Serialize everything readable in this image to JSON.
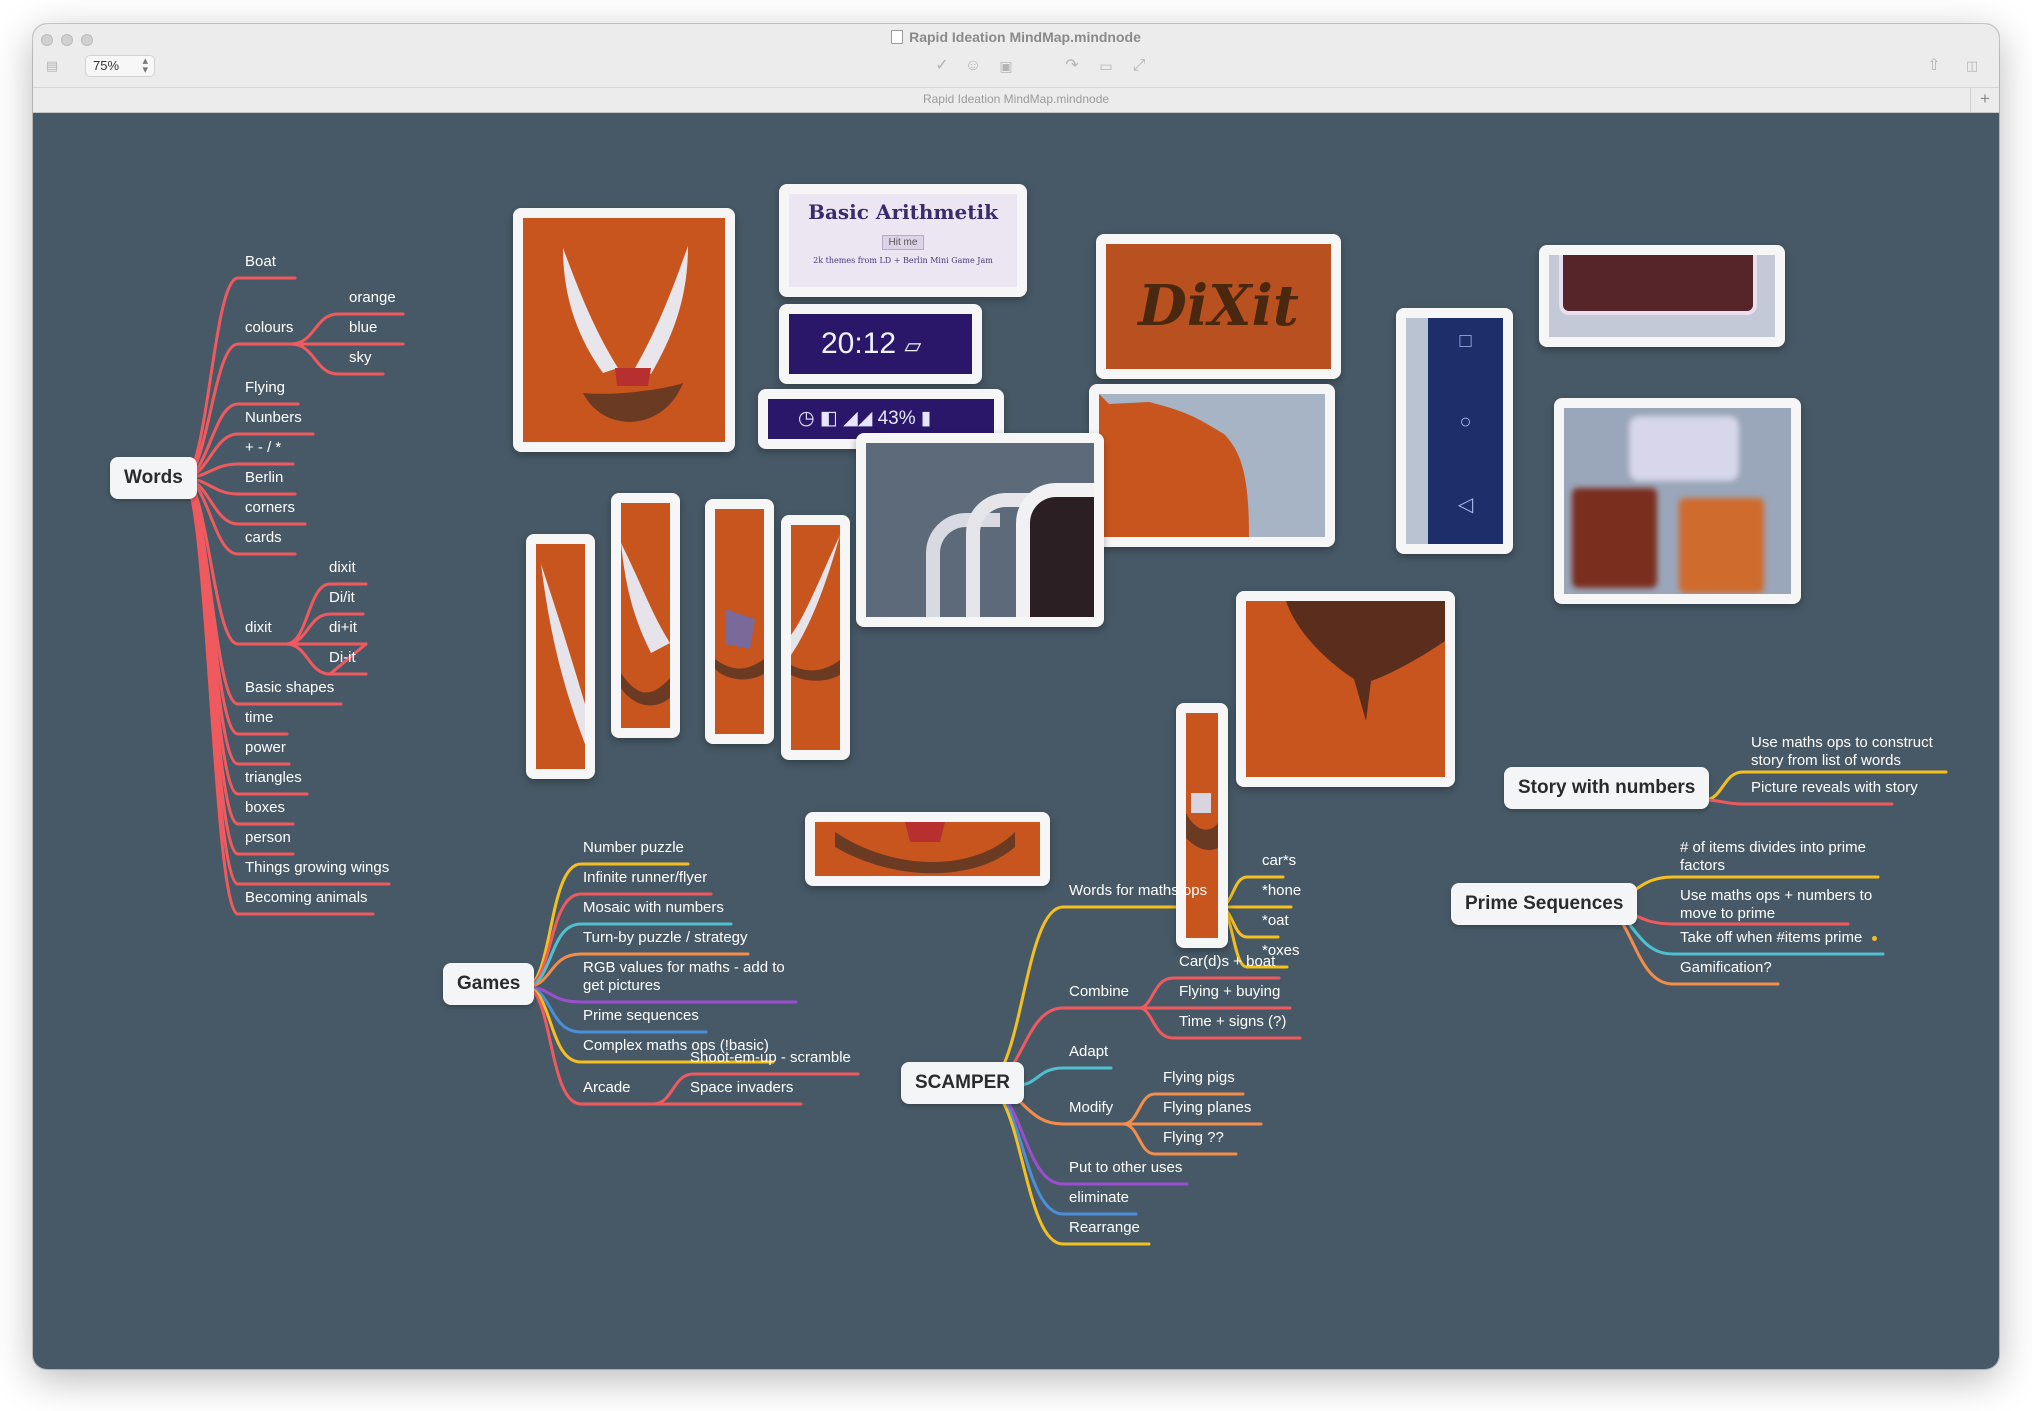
{
  "window": {
    "title": "Rapid Ideation MindMap.mindnode",
    "tab_label": "Rapid Ideation MindMap.mindnode",
    "zoom": "75%",
    "add_tab_label": "+"
  },
  "toolbar_icons": [
    "sidebar-icon",
    "check-icon",
    "smiley-icon",
    "image-icon",
    "undo-icon",
    "link-icon",
    "collapse-icon",
    "share-icon",
    "inspector-icon"
  ],
  "colors": {
    "canvas": "#475966",
    "red": "#f05a5f",
    "yellow": "#f4c021",
    "cyan": "#4fc0d0",
    "orange": "#f58d4a",
    "purple": "#9b4fd0",
    "blue": "#4a8fd8",
    "node_bg": "#f4f5f6"
  },
  "images": {
    "arithmetik_title": "Basic Arithmetik",
    "arithmetik_button": "Hit me",
    "arithmetik_footer": "2k themes from LD + Berlin Mini Game Jam",
    "clock_time": "20:12",
    "battery": "43%",
    "dixit_logo": "DiXit"
  },
  "words": {
    "root": "Words",
    "boat": "Boat",
    "colours": "colours",
    "orange": "orange",
    "blue": "blue",
    "sky": "sky",
    "flying": "Flying",
    "nunbers": "Nunbers",
    "ops": "+ - / *",
    "berlin": "Berlin",
    "corners": "corners",
    "cards": "cards",
    "dixit": "dixit",
    "dixit_1": "dixit",
    "dixit_2": "Di/it",
    "dixit_3": "di+it",
    "dixit_4": "Di-it",
    "basic_shapes": "Basic shapes",
    "time": "time",
    "power": "power",
    "triangles": "triangles",
    "boxes": "boxes",
    "person": "person",
    "things_growing_wings": "Things growing wings",
    "becoming_animals": "Becoming animals"
  },
  "games": {
    "root": "Games",
    "number_puzzle": "Number puzzle",
    "infinite_runner": "Infinite runner/flyer",
    "mosaic": "Mosaic with numbers",
    "turn_by": "Turn-by puzzle / strategy",
    "rgb_1": "RGB values for maths - add to",
    "rgb_2": "get pictures",
    "prime_sequences": "Prime sequences",
    "complex_ops": "Complex maths ops (!basic)",
    "arcade": "Arcade",
    "shoot_em_up": "Shoot-em-up - scramble",
    "space_invaders": "Space invaders"
  },
  "scamper": {
    "root": "SCAMPER",
    "words_for_maths": "Words for maths ops",
    "cars": "car*s",
    "hone": "*hone",
    "oat": "*oat",
    "oxes": "*oxes",
    "combine": "Combine",
    "cards_boat": "Car(d)s + boat",
    "flying_buying": "Flying + buying",
    "time_signs": "Time + signs (?)",
    "adapt": "Adapt",
    "modify": "Modify",
    "flying_pigs": "Flying pigs",
    "flying_planes": "Flying planes",
    "flying_qq": "Flying ??",
    "put_to_other_uses": "Put to other uses",
    "eliminate": "eliminate",
    "rearrange": "Rearrange"
  },
  "story": {
    "root": "Story with numbers",
    "use_maths_1": "Use maths ops to construct",
    "use_maths_2": "story from list of words",
    "picture_reveals": "Picture reveals with story"
  },
  "prime": {
    "root": "Prime Sequences",
    "items_divides_1": "# of items divides into prime",
    "items_divides_2": "factors",
    "use_maths_1": "Use maths ops + numbers to",
    "use_maths_2": "move to prime",
    "take_off": "Take off when #items prime",
    "gamification": "Gamification?"
  }
}
